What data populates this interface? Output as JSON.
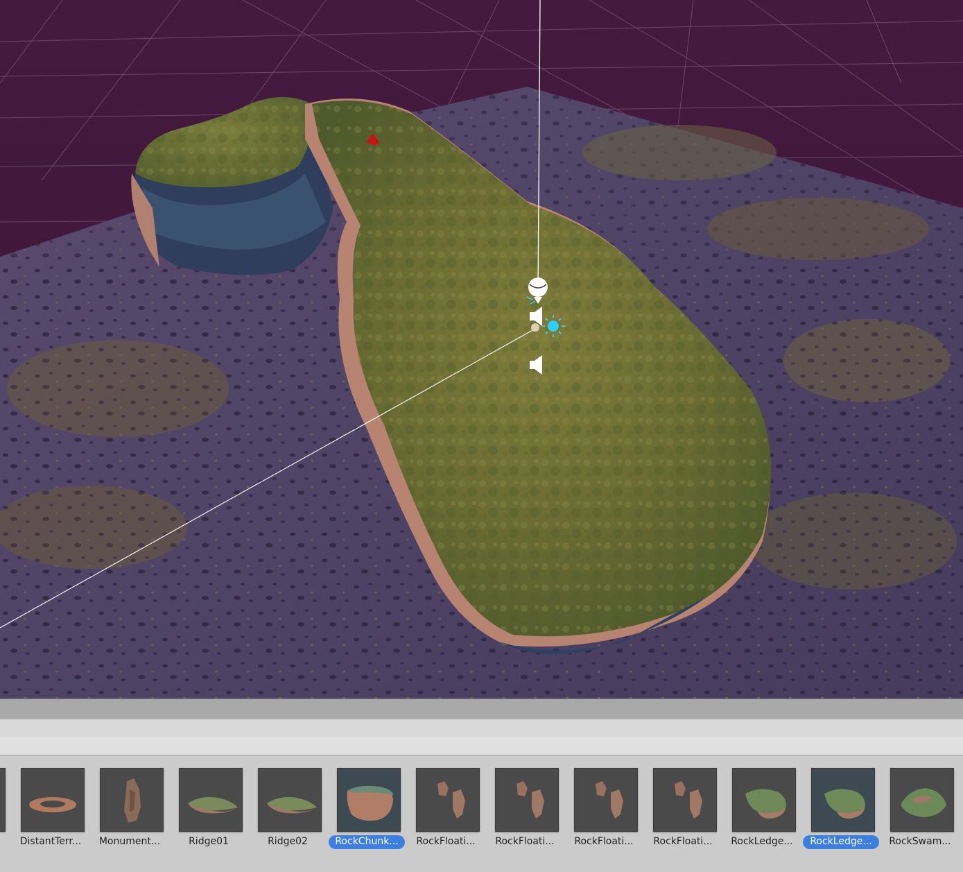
{
  "viewport": {
    "background_color": "#3d1838",
    "terrain_color": "#5a4a66",
    "moss_color": "#6b6a2e"
  },
  "gizmos": {
    "camera_icon": "camera-gizmo-icon",
    "audio_icon": "audio-source-icon",
    "light_icon": "light-gizmo-icon",
    "marker_icon": "red-marker-icon"
  },
  "assets": {
    "items": [
      {
        "label": "",
        "selected": false,
        "icon": "partial-thumbnail"
      },
      {
        "label": "DistantTerr...",
        "selected": false,
        "icon": "ring-terrain-thumbnail"
      },
      {
        "label": "Monument...",
        "selected": false,
        "icon": "monument-rock-thumbnail"
      },
      {
        "label": "Ridge01",
        "selected": false,
        "icon": "ridge-thumbnail"
      },
      {
        "label": "Ridge02",
        "selected": false,
        "icon": "ridge-thumbnail"
      },
      {
        "label": "RockChunk...",
        "selected": true,
        "icon": "rock-chunk-thumbnail"
      },
      {
        "label": "RockFloati...",
        "selected": false,
        "icon": "floating-rock-thumbnail"
      },
      {
        "label": "RockFloati...",
        "selected": false,
        "icon": "floating-rock-thumbnail"
      },
      {
        "label": "RockFloati...",
        "selected": false,
        "icon": "floating-rock-thumbnail"
      },
      {
        "label": "RockFloati...",
        "selected": false,
        "icon": "floating-rock-thumbnail"
      },
      {
        "label": "RockLedge...",
        "selected": false,
        "icon": "rock-ledge-thumbnail"
      },
      {
        "label": "RockLedge...",
        "selected": true,
        "icon": "rock-ledge-thumbnail"
      },
      {
        "label": "RockSwam...",
        "selected": false,
        "icon": "rock-swamp-thumbnail"
      }
    ],
    "selected_color": "#3d7fe0"
  }
}
